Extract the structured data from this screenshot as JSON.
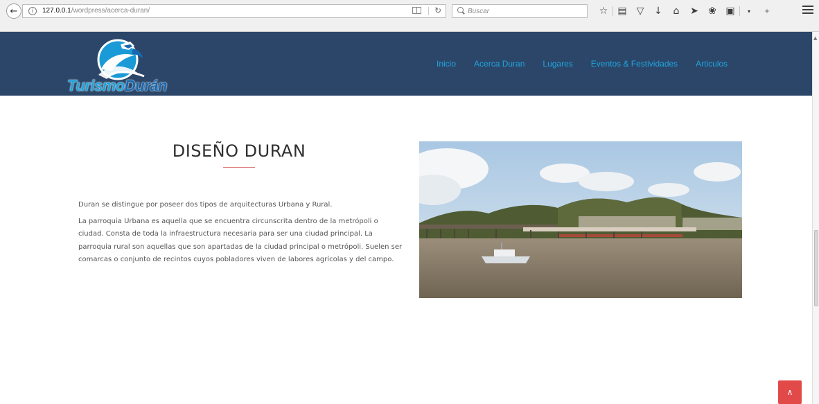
{
  "browser": {
    "url_host": "127.0.0.1",
    "url_path": "/wordpress/acerca-duran/",
    "search_placeholder": "Buscar"
  },
  "site": {
    "logo_text_1": "Turismo",
    "logo_text_2": "Durán",
    "nav": [
      "Inicio",
      "Acerca Duran",
      "Lugares",
      "Eventos & Festividades",
      "Articulos"
    ],
    "colors": {
      "header_bg": "#2b4668",
      "nav_link": "#21a5df",
      "accent": "#e24a4a"
    }
  },
  "content": {
    "title": "DISEÑO DURAN",
    "paragraphs": [
      "Duran se distingue por poseer dos tipos de arquitecturas Urbana y Rural.",
      "La parroquia Urbana es aquella que se encuentra circunscrita dentro de la metrópoli o ciudad. Consta de toda la infraestructura necesaria para ser una ciudad principal. La parroquia rural son aquellas que son apartadas de la ciudad principal o metrópoli. Suelen ser comarcas o conjunto de recintos cuyos pobladores viven de labores agrícolas y del campo."
    ]
  }
}
